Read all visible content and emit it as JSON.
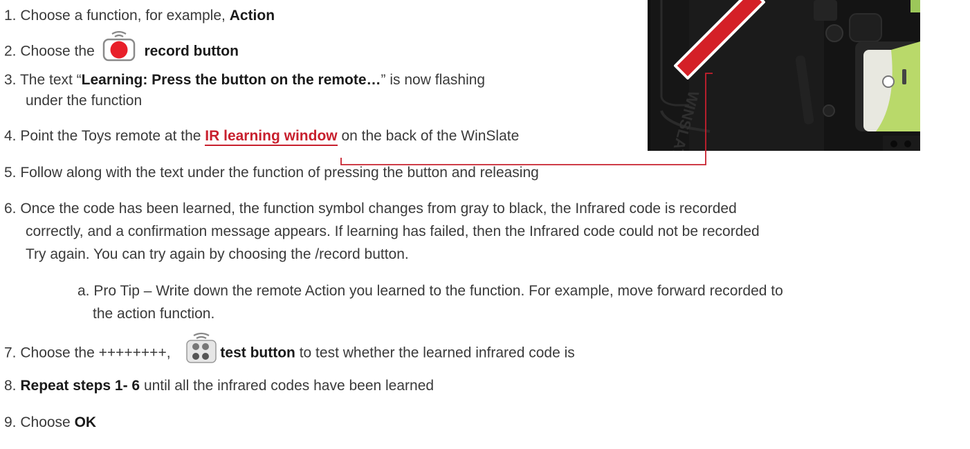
{
  "steps": [
    {
      "num": "1.",
      "pre": " Choose a function, for example, ",
      "bold": "Action"
    },
    {
      "num": "2.",
      "pre": " Choose the ",
      "bold": "record button",
      "icon": "record-icon"
    },
    {
      "num": "3.",
      "pre": " The text “",
      "bold": "Learning: Press the button on the remote…",
      "post": "” is now flashing",
      "cont": "under the function"
    },
    {
      "num": "4.",
      "pre": " Point the Toys remote at the ",
      "link": "IR learning window",
      "post": " on the back of the WinSlate"
    },
    {
      "num": "5.",
      "pre": " Follow along with the text under the function of pressing the button and releasing"
    },
    {
      "num": "6.",
      "line1": " Once the code has been learned, the function symbol changes from gray to black, the Infrared code is recorded",
      "line2": "correctly, and a confirmation message appears. If learning has failed, then the Infrared code could not be recorded",
      "line3": "Try again. You can try again by choosing the /record button."
    },
    {
      "num": "a.",
      "line1": " Pro Tip – Write down the remote Action you learned to the function. For example, move forward recorded to",
      "line2": "the action function."
    },
    {
      "num": "7.",
      "pre": " Choose the ++++++++,",
      "bold": "test button",
      "post": " to test whether the learned infrared code is",
      "icon": "test-icon"
    },
    {
      "num": "8.",
      "bold": "Repeat steps 1- 6",
      "post": " until all the infrared codes have been learned"
    },
    {
      "num": "9.",
      "pre": " Choose ",
      "bold": "OK"
    }
  ],
  "colors": {
    "accent": "#c8202e",
    "text": "#3a3a3a",
    "record": "#e8202a"
  },
  "photo": {
    "printed_text": "WINSLATE"
  }
}
